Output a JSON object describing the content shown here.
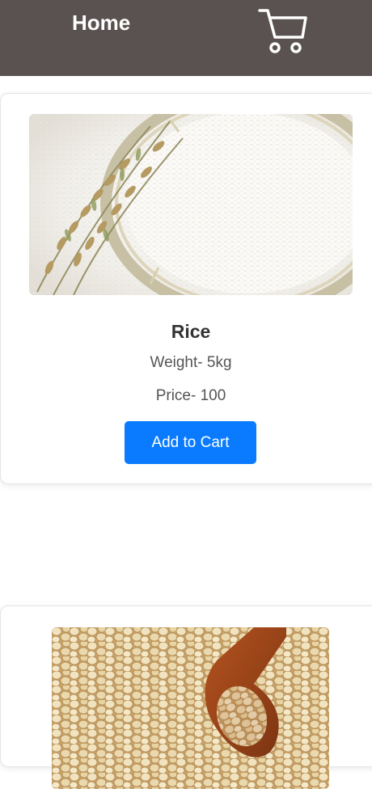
{
  "header": {
    "home_label": "Home",
    "background": "#5a5250",
    "cart_icon": "shopping-cart-icon"
  },
  "products": [
    {
      "name": "Rice",
      "weight": "Weight- 5kg",
      "price": "Price- 100",
      "add_label": "Add to Cart"
    },
    {
      "image": "dal-photo"
    }
  ],
  "colors": {
    "accent": "#0a7bff",
    "card_border": "#e4e4e4"
  }
}
